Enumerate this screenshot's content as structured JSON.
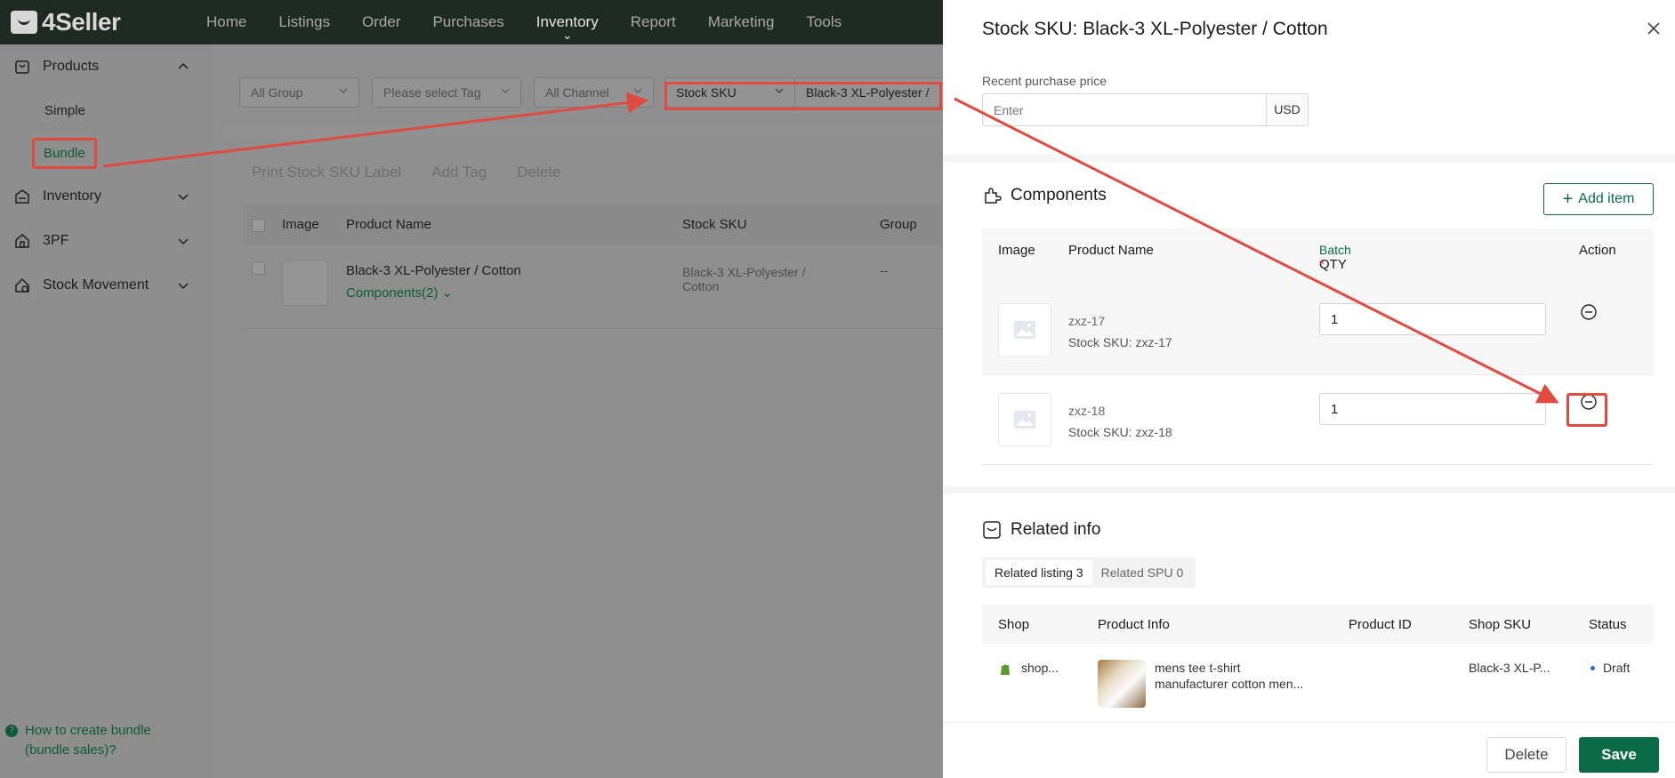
{
  "app": {
    "logo": "4Seller",
    "nav": [
      "Home",
      "Listings",
      "Order",
      "Purchases",
      "Inventory",
      "Report",
      "Marketing",
      "Tools"
    ],
    "active_nav": "Inventory"
  },
  "sidebar": {
    "products": "Products",
    "simple": "Simple",
    "bundle": "Bundle",
    "inventory": "Inventory",
    "threepf": "3PF",
    "stock_movement": "Stock Movement",
    "help": "How to create bundle (bundle sales)?"
  },
  "filters": {
    "group": "All Group",
    "tag": "Please select Tag",
    "channel": "All Channel",
    "search_field": "Stock SKU",
    "search_value": "Black-3 XL-Polyester /"
  },
  "list": {
    "actions": [
      "Print Stock SKU Label",
      "Add Tag",
      "Delete"
    ],
    "headers": {
      "image": "Image",
      "product_name": "Product Name",
      "stock_sku": "Stock SKU",
      "group": "Group"
    },
    "row": {
      "product_name": "Black-3 XL-Polyester / Cotton",
      "components": "Components(2)",
      "stock_sku": "Black-3 XL-Polyester / Cotton",
      "group": "--"
    }
  },
  "drawer": {
    "title": "Stock SKU: Black-3 XL-Polyester / Cotton",
    "price_label": "Recent purchase price",
    "price_placeholder": "Enter",
    "currency": "USD",
    "components_title": "Components",
    "add_item": "Add item",
    "comp_headers": {
      "image": "Image",
      "product_name": "Product Name",
      "qty": "QTY",
      "required": "*",
      "batch": "Batch",
      "action": "Action"
    },
    "components": [
      {
        "name": "zxz-17",
        "sku": "Stock SKU: zxz-17",
        "qty": "1"
      },
      {
        "name": "zxz-18",
        "sku": "Stock SKU: zxz-18",
        "qty": "1"
      }
    ],
    "related_title": "Related info",
    "tabs": [
      {
        "label": "Related listing",
        "count": "3"
      },
      {
        "label": "Related SPU",
        "count": "0"
      }
    ],
    "related_headers": {
      "shop": "Shop",
      "product_info": "Product Info",
      "product_id": "Product ID",
      "shop_sku": "Shop SKU",
      "status": "Status"
    },
    "related_row": {
      "shop": "shop...",
      "product_info_1": "mens tee t-shirt",
      "product_info_2": "manufacturer cotton men...",
      "shop_sku": "Black-3 XL-P...",
      "status": "Draft"
    },
    "delete": "Delete",
    "save": "Save"
  },
  "colors": {
    "brand": "#0b6b47",
    "annotation": "#e14b3f",
    "status_draft": "#1f6fe5"
  }
}
